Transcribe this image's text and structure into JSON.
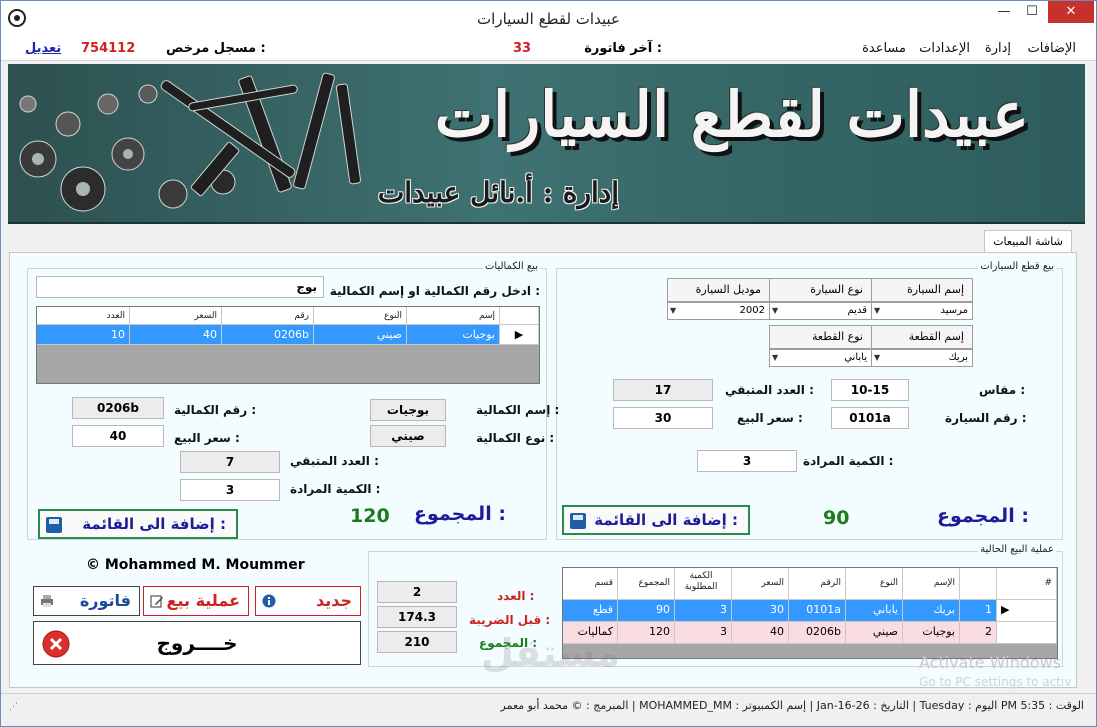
{
  "window": {
    "title": "عبيدات لقطع السيارات",
    "min": "—",
    "max": "☐",
    "close": "✕"
  },
  "menu": {
    "items": [
      "الإضافات",
      "إدارة",
      "الإعدادات",
      "مساعدة"
    ],
    "last_invoice_label": "آخر فاتورة :",
    "last_invoice_value": "33",
    "licensed_label": "مسجل مرخص :",
    "licensed_value": "754112",
    "edit_link": "تعديل"
  },
  "banner": {
    "title": "عبيدات لقطع السيارات",
    "subtitle": "إدارة : أ.نائل عبيدات"
  },
  "tab": {
    "label": "شاشة المبيعات"
  },
  "car_parts": {
    "legend": "بيع قطع السيارات",
    "headers_top": [
      "إسم السيارة",
      "نوع السيارة",
      "موديل السيارة"
    ],
    "values_top": [
      "مرسيد",
      "قديم",
      "2002"
    ],
    "headers_bottom": [
      "إسم القطعة",
      "نوع القطعة"
    ],
    "values_bottom": [
      "بريك",
      "ياباني"
    ],
    "size_label": "مقاس :",
    "size_value": "10-15",
    "remaining_label": "العدد المتبقي :",
    "remaining_value": "17",
    "car_no_label": "رقم السيارة :",
    "car_no_value": "0101a",
    "price_label": "سعر البيع :",
    "price_value": "30",
    "qty_label": "الكمية المرادة :",
    "qty_value": "3",
    "total_label": "المجموع :",
    "total_value": "90",
    "add_button": "إضافة الى القائمة :"
  },
  "accessories": {
    "legend": "بيع الكماليات",
    "search_label": "ادخل رقم الكمالية او إسم الكمالية :",
    "search_value": "بوج",
    "grid_headers": [
      "إسم",
      "النوع",
      "رقم",
      "السعر",
      "العدد"
    ],
    "grid_rows": [
      [
        "بوجيات",
        "صيني",
        "0206b",
        "40",
        "10"
      ]
    ],
    "name_label": "إسم الكمالية :",
    "name_value": "بوجيات",
    "number_label": "رقم الكمالية :",
    "number_value": "0206b",
    "type_label": "نوع الكمالية :",
    "type_value": "صيني",
    "price_label": "سعر البيع :",
    "price_value": "40",
    "remaining_label": "العدد المتبقي :",
    "remaining_value": "7",
    "qty_label": "الكمية المرادة :",
    "qty_value": "3",
    "total_label": "المجموع :",
    "total_value": "120",
    "add_button": "إضافة الى القائمة :"
  },
  "current_sale": {
    "legend": "عملية البيع الحالية",
    "grid_headers": [
      "#",
      "الإسم",
      "النوع",
      "الرقم",
      "السعر",
      "الكمية المطلوبة",
      "المجموع",
      "قسم"
    ],
    "grid_rows": [
      [
        "1",
        "بريك",
        "ياباني",
        "0101a",
        "30",
        "3",
        "90",
        "قطع"
      ],
      [
        "2",
        "بوجيات",
        "صيني",
        "0206b",
        "40",
        "3",
        "120",
        "كماليات"
      ]
    ],
    "count_label": "العدد :",
    "count_value": "2",
    "pretax_label": "قبل الضريبة :",
    "pretax_value": "174.3",
    "sum_label": "المجموع :",
    "sum_value": "210"
  },
  "actions": {
    "copyright": "© Mohammed M. Moummer",
    "invoice": "فاتورة",
    "sale": "عملية بيع",
    "new": "جديد",
    "exit": "خــــروج"
  },
  "status": {
    "text": "الوقت : 5:35 PM اليوم : Tuesday | التاريخ : 26-Jan-16 | إسم الكمبيوتر : MOHAMMED_MM | المبرمج : © محمد أبو معمر"
  },
  "overlay": {
    "activate_title": "Activate Windows",
    "activate_hint": "Go to PC settings to activ",
    "watermark": "مستقل"
  },
  "colors": {
    "selected_row": "#3399ff",
    "pink_row": "#f9dde0",
    "total_blue": "#1d1d9a",
    "total_green": "#1a7d1a",
    "close_red": "#c7312c"
  }
}
